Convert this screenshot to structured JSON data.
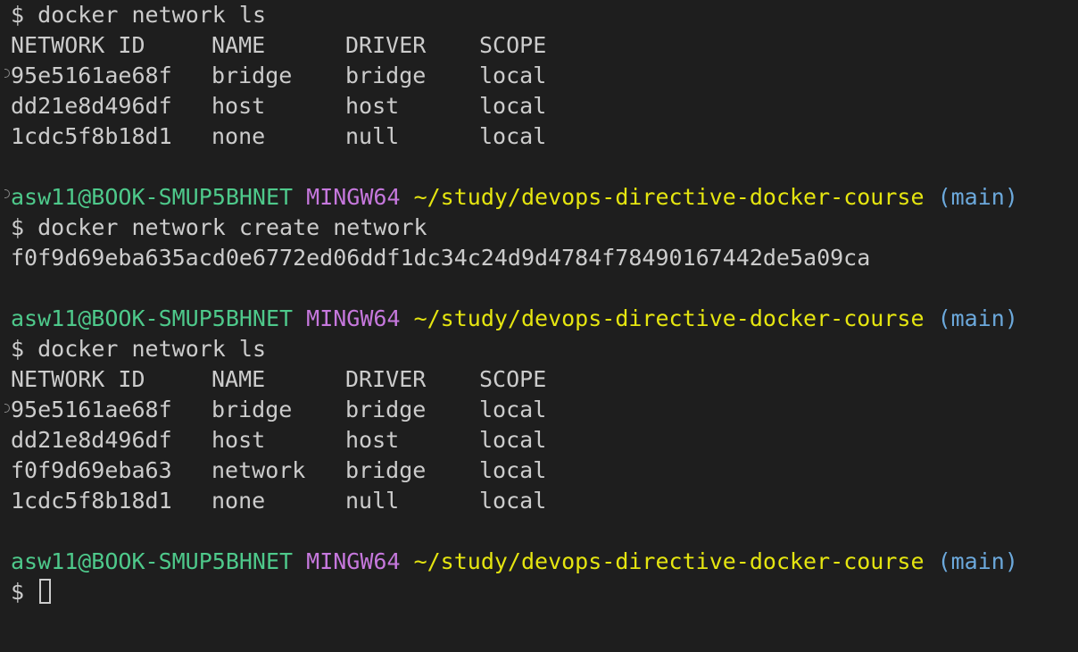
{
  "terminal": {
    "prompt_symbol": "$",
    "prompt": {
      "user_host": "asw11@BOOK-SMUP5BHNET",
      "system": "MINGW64",
      "path": "~/study/devops-directive-docker-course",
      "branch": "(main)"
    },
    "commands": {
      "ls1": "docker network ls",
      "create": "docker network create network",
      "ls2": "docker network ls"
    },
    "create_output": "f0f9d69eba635acd0e6772ed06ddf1dc34c24d9d4784f78490167442de5a09ca",
    "table_headers": [
      "NETWORK ID",
      "NAME",
      "DRIVER",
      "SCOPE"
    ],
    "table1": [
      [
        "95e5161ae68f",
        "bridge",
        "bridge",
        "local"
      ],
      [
        "dd21e8d496df",
        "host",
        "host",
        "local"
      ],
      [
        "1cdc5f8b18d1",
        "none",
        "null",
        "local"
      ]
    ],
    "table2": [
      [
        "95e5161ae68f",
        "bridge",
        "bridge",
        "local"
      ],
      [
        "dd21e8d496df",
        "host",
        "host",
        "local"
      ],
      [
        "f0f9d69eba63",
        "network",
        "bridge",
        "local"
      ],
      [
        "1cdc5f8b18d1",
        "none",
        "null",
        "local"
      ]
    ]
  },
  "colors": {
    "background": "#1e1e1e",
    "text": "#cccccc",
    "user_host": "#4ec98b",
    "system": "#c678dd",
    "path": "#e5e510",
    "branch": "#6ca9dc"
  }
}
